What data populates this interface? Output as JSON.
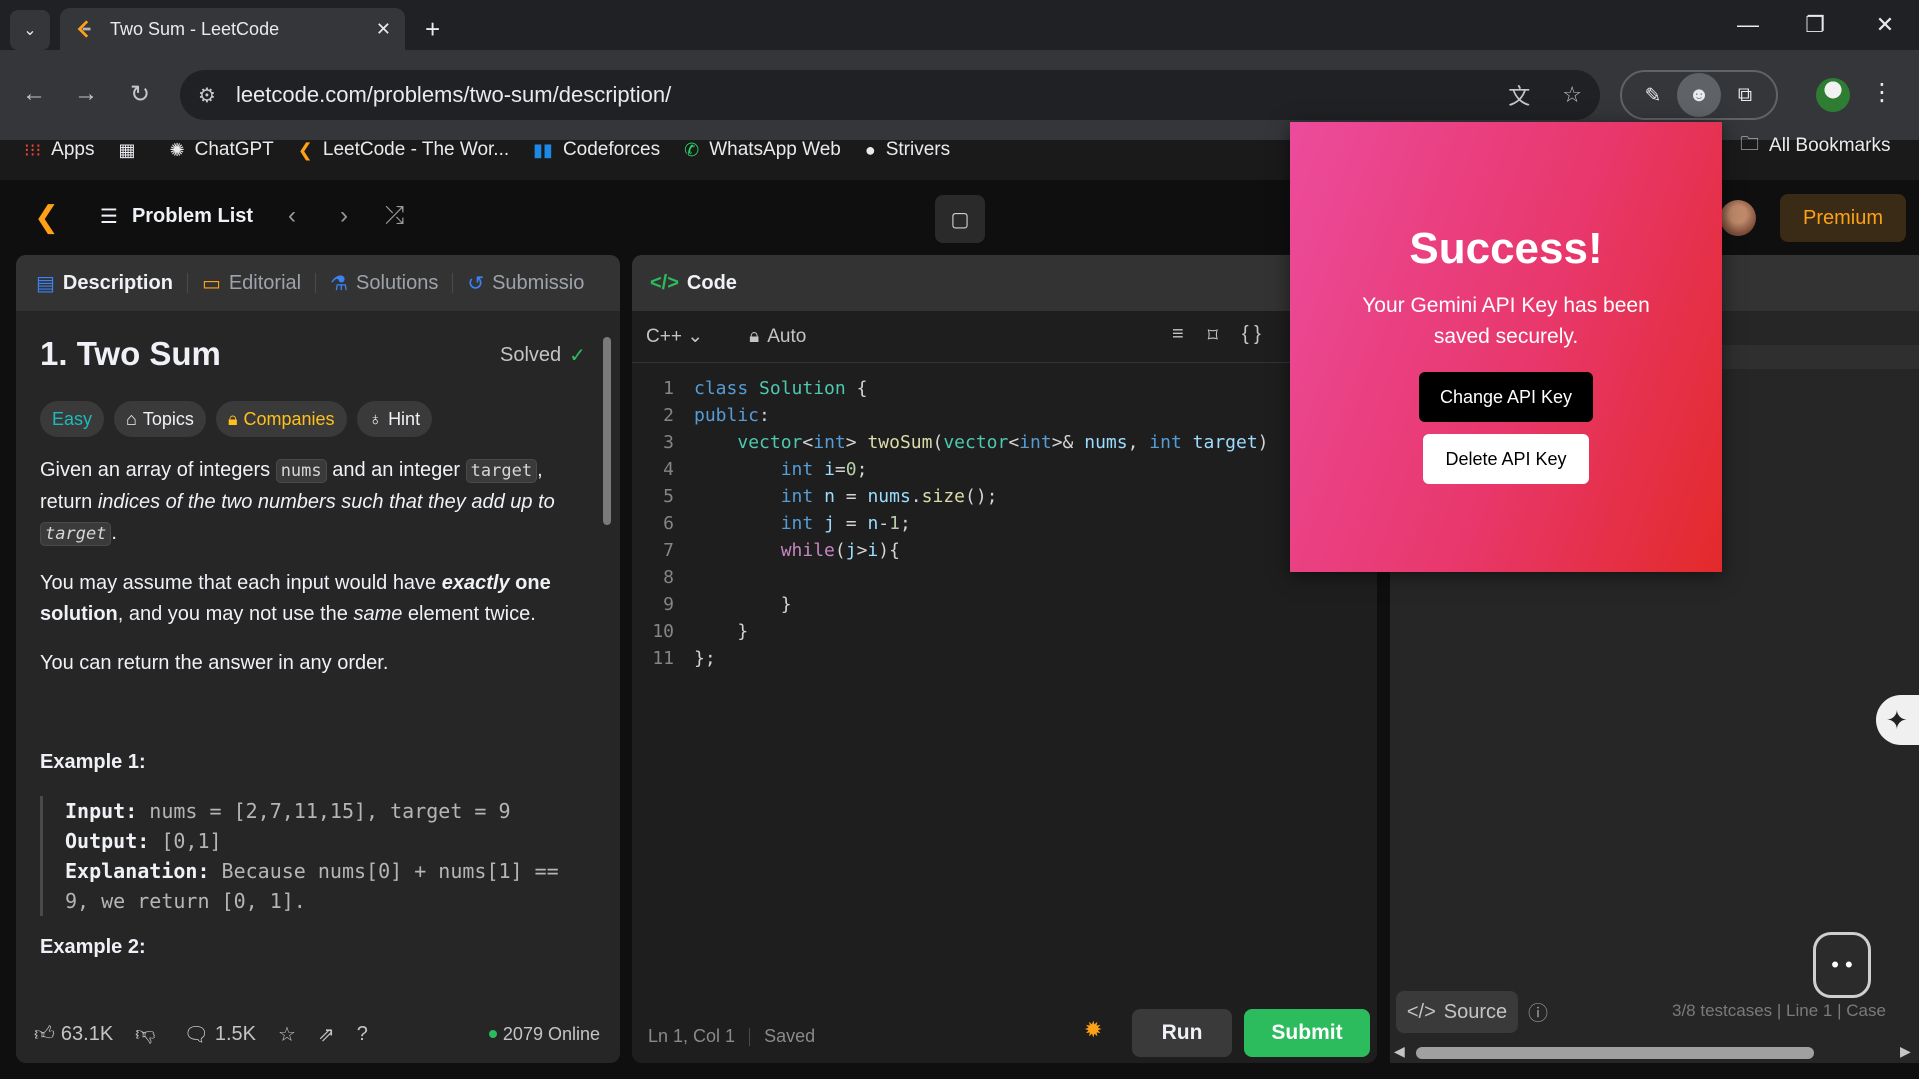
{
  "browser": {
    "tab_title": "Two Sum - LeetCode",
    "url": "leetcode.com/problems/two-sum/description/",
    "bookmarks": [
      "Apps",
      "ChatGPT",
      "LeetCode - The Wor...",
      "Codeforces",
      "WhatsApp Web",
      "Strivers"
    ],
    "all_bookmarks": "All Bookmarks"
  },
  "lc_nav": {
    "problem_list": "Problem List",
    "premium": "Premium"
  },
  "desc_tabs": [
    "Description",
    "Editorial",
    "Solutions",
    "Submissio"
  ],
  "problem": {
    "title": "1. Two Sum",
    "status": "Solved",
    "tags": [
      "Easy",
      "Topics",
      "Companies",
      "Hint"
    ],
    "p1_a": "Given an array of integers ",
    "p1_nums": "nums",
    "p1_b": " and an integer ",
    "p1_target": "target",
    "p1_c": ", return ",
    "p1_em": "indices of the two numbers such that they add up to",
    "p1_target2": "target",
    "p1_end": ".",
    "p2_a": "You may assume that each input would have ",
    "p2_em": "exactly",
    "p2_b1": " one solution",
    "p2_c": ", and you may not use the ",
    "p2_same": "same",
    "p2_d": " element twice.",
    "p3": "You can return the answer in any order.",
    "ex1_title": "Example 1:",
    "ex1_input_label": "Input:",
    "ex1_input": " nums = [2,7,11,15], target = 9",
    "ex1_output_label": "Output:",
    "ex1_output": " [0,1]",
    "ex1_expl_label": "Explanation:",
    "ex1_expl": " Because nums[0] + nums[1] == 9, we return [0, 1].",
    "ex2_title": "Example 2:"
  },
  "desc_footer": {
    "likes": "63.1K",
    "comments": "1.5K",
    "online": "2079 Online"
  },
  "code_panel": {
    "title": "Code",
    "language": "C++",
    "mode": "Auto",
    "status_pos": "Ln 1, Col 1",
    "status_saved": "Saved",
    "run": "Run",
    "submit": "Submit"
  },
  "code_lines": [
    "1",
    "2",
    "3",
    "4",
    "5",
    "6",
    "7",
    "8",
    "9",
    "10",
    "11"
  ],
  "test_panel": {
    "source": "Source",
    "info": "3/8 testcases  |  Line 1  |  Case"
  },
  "popup": {
    "title": "Success!",
    "message": "Your Gemini API Key has been saved securely.",
    "change": "Change API Key",
    "delete": "Delete API Key"
  }
}
